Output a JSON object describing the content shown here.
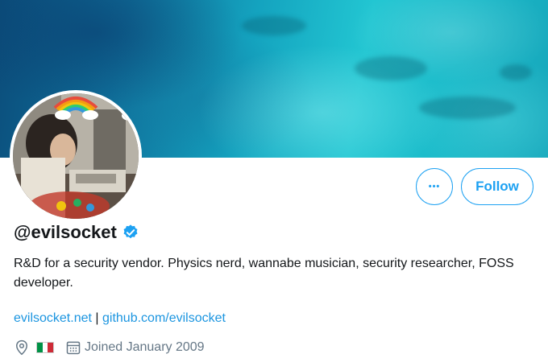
{
  "profile": {
    "handle": "@evilsocket",
    "bio": "R&D for a security vendor. Physics nerd, wannabe musician, security researcher, FOSS developer.",
    "links": [
      "evilsocket.net",
      "github.com/evilsocket"
    ],
    "link_separator": "|",
    "location_flag": "IT",
    "joined": "Joined January 2009",
    "verified": true
  },
  "actions": {
    "more_label": "•••",
    "follow_label": "Follow"
  },
  "colors": {
    "accent": "#1da1f2",
    "link": "#1b95e0",
    "muted": "#657786",
    "flag_green": "#009246",
    "flag_white": "#ffffff",
    "flag_red": "#ce2b37"
  },
  "icons": {
    "location": "location-pin-icon",
    "calendar": "calendar-icon",
    "verified": "verified-badge-icon",
    "more": "more-dots-icon"
  }
}
